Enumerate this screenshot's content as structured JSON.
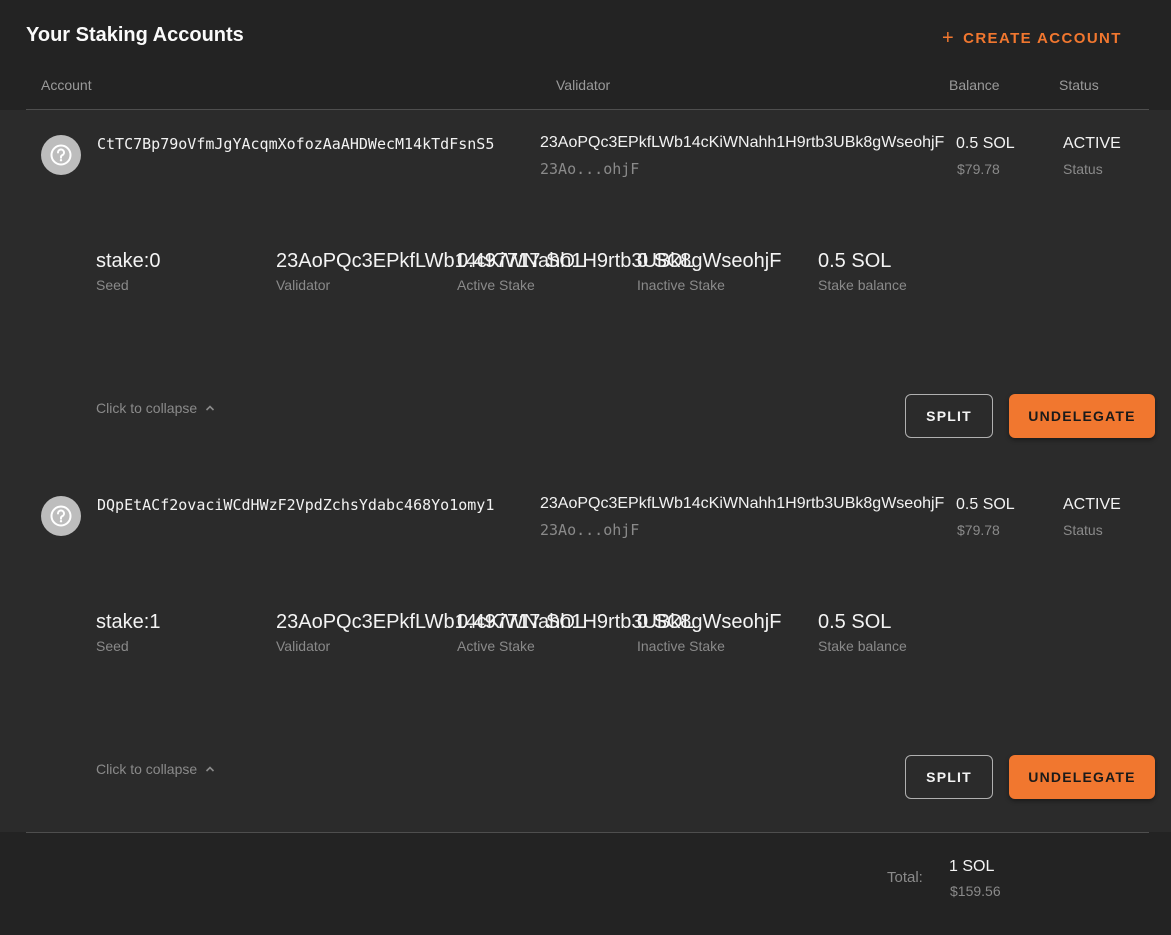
{
  "page": {
    "title": "Your Staking Accounts",
    "create_label": "CREATE ACCOUNT",
    "accent_color": "#f1772f"
  },
  "columns": [
    "Account",
    "Validator",
    "Balance",
    "Status"
  ],
  "accounts": [
    {
      "address": "CtTC7Bp79oVfmJgYAcqmXofozAaAHDWecM14kTdFsnS5",
      "validator": "23AoPQc3EPkfLWb14cKiWNahh1H9rtb3UBk8gWseohjF",
      "validator_short": "23Ao...ohjF",
      "balance": "0.5 SOL",
      "balance_usd": "$79.78",
      "status": "ACTIVE",
      "status_label": "Status",
      "details": {
        "seed": "stake:0",
        "seed_label": "Seed",
        "validator": "23AoPQc3EPkfLWb14cKiWNahh1H9rtb3UBk8gWseohjF",
        "validator_label": "Validator",
        "active_stake": "0.497717 SOL",
        "active_stake_label": "Active Stake",
        "inactive_stake": "0 SOL",
        "inactive_stake_label": "Inactive Stake",
        "stake_balance": "0.5 SOL",
        "stake_balance_label": "Stake balance"
      },
      "collapse_label": "Click to collapse",
      "split_label": "SPLIT",
      "undelegate_label": "UNDELEGATE"
    },
    {
      "address": "DQpEtACf2ovaciWCdHWzF2VpdZchsYdabc468Yo1omy1",
      "validator": "23AoPQc3EPkfLWb14cKiWNahh1H9rtb3UBk8gWseohjF",
      "validator_short": "23Ao...ohjF",
      "balance": "0.5 SOL",
      "balance_usd": "$79.78",
      "status": "ACTIVE",
      "status_label": "Status",
      "details": {
        "seed": "stake:1",
        "seed_label": "Seed",
        "validator": "23AoPQc3EPkfLWb14cKiWNahh1H9rtb3UBk8gWseohjF",
        "validator_label": "Validator",
        "active_stake": "0.497717 SOL",
        "active_stake_label": "Active Stake",
        "inactive_stake": "0 SOL",
        "inactive_stake_label": "Inactive Stake",
        "stake_balance": "0.5 SOL",
        "stake_balance_label": "Stake balance"
      },
      "collapse_label": "Click to collapse",
      "split_label": "SPLIT",
      "undelegate_label": "UNDELEGATE"
    }
  ],
  "total": {
    "label": "Total:",
    "sol": "1 SOL",
    "usd": "$159.56"
  }
}
